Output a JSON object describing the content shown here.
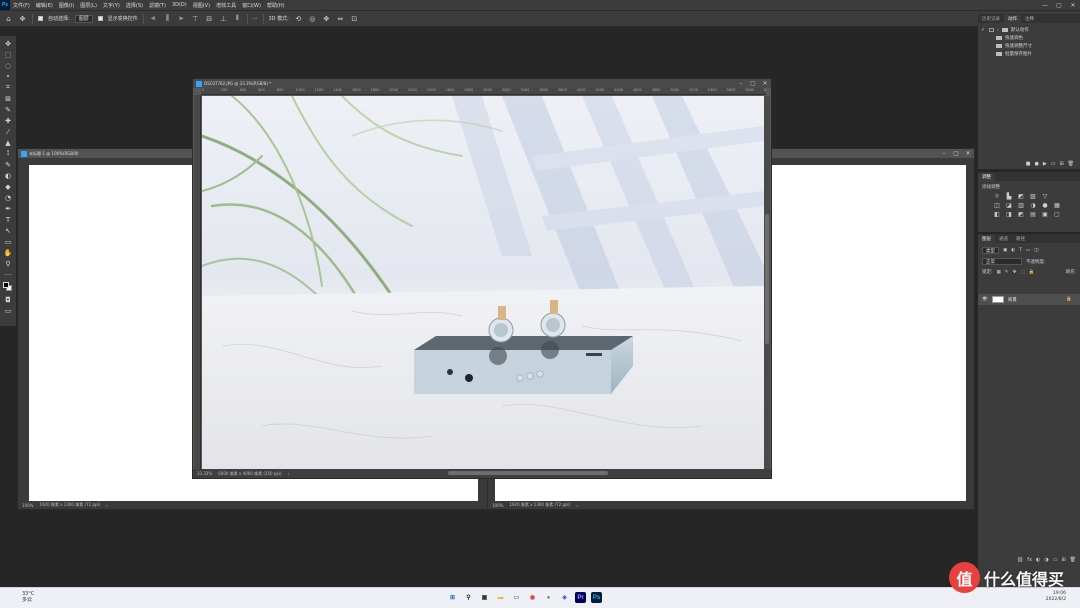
{
  "menubar": {
    "logo": "Ps",
    "items": [
      "文件(F)",
      "编辑(E)",
      "图像(I)",
      "图层(L)",
      "文字(Y)",
      "选择(S)",
      "滤镜(T)",
      "3D(D)",
      "视图(V)",
      "增效工具",
      "窗口(W)",
      "帮助(H)"
    ],
    "win_controls": [
      "—",
      "▢",
      "✕"
    ]
  },
  "options_bar": {
    "home_icon": "home-icon",
    "move_icon": "move-icon",
    "auto_select_label": "自动选择:",
    "layer_select": "图层",
    "show_transform_label": "显示变换控件",
    "more": "···",
    "mode_3d": "3D 模式:"
  },
  "toolbar": {
    "tools": [
      "✥",
      "⬚",
      "◌",
      "⬩",
      "⌗",
      "⊠",
      "✎",
      "✚",
      "⁄",
      "▲",
      "⟟",
      "✎",
      "◐",
      "◆",
      "◔",
      "✒",
      "T",
      "↖",
      "▭",
      "✋",
      "⚲",
      "···"
    ],
    "colors": {
      "foreground": "#000000",
      "background": "#ffffff"
    }
  },
  "doc_back_left": {
    "title": "未标题-1 @ 100%(RGB/8)",
    "status_zoom": "100%",
    "status_info": "1920 像素 x 1300 像素 (72 ppi)"
  },
  "doc_back_right": {
    "status_zoom": "100%",
    "status_info": "1920 像素 x 1300 像素 (72 ppi)"
  },
  "doc_front": {
    "title": "DSC07762.JPG @ 33.3%(RGB/8) *",
    "status_zoom": "33.33%",
    "status_info": "6000 像素 x 4000 像素 (350 ppi)",
    "ruler_ticks": [
      "0",
      "200",
      "400",
      "600",
      "800",
      "1000",
      "1200",
      "1400",
      "1600",
      "1800",
      "2000",
      "2200",
      "2400",
      "2600",
      "2800",
      "3000",
      "3200",
      "3400",
      "3600",
      "3800",
      "4000",
      "4200",
      "4400",
      "4600",
      "4800",
      "5000",
      "5200",
      "5400",
      "5600",
      "5800",
      "6000"
    ]
  },
  "panel_history": {
    "tabs": [
      "历史记录",
      "动作",
      "注释"
    ],
    "actions": [
      {
        "label": "默认动作",
        "folder": true
      },
      {
        "label": "快速调色",
        "folder": false
      },
      {
        "label": "快速调整尺寸",
        "folder": false
      },
      {
        "label": "批量保存图片",
        "folder": false
      }
    ]
  },
  "panel_adjust": {
    "tabs": [
      "调整"
    ],
    "subtitle": "添加调整",
    "icons": [
      "☼",
      "▙",
      "◩",
      "▨",
      "▽",
      "",
      "◫",
      "◪",
      "▥",
      "◑",
      "●",
      "▦",
      "◧",
      "◨",
      "◩",
      "▤",
      "▣",
      "▢"
    ]
  },
  "panel_layers": {
    "tabs": [
      "图层",
      "通道",
      "路径"
    ],
    "kind_label": "类型",
    "mode_label": "正常",
    "opacity_label": "不透明度:",
    "lock_label": "锁定:",
    "fill_label": "填充:",
    "layer_name": "背景"
  },
  "taskbar": {
    "weather_temp": "33°C",
    "weather_desc": "多云",
    "apps": [
      {
        "name": "start",
        "glyph": "⊞",
        "color": "#1f6fd6"
      },
      {
        "name": "search",
        "glyph": "⚲",
        "color": "#222222"
      },
      {
        "name": "taskview",
        "glyph": "▣",
        "color": "#333333"
      },
      {
        "name": "explorer",
        "glyph": "▬",
        "color": "#e8b530"
      },
      {
        "name": "files",
        "glyph": "▭",
        "color": "#4a8ee0"
      },
      {
        "name": "chrome",
        "glyph": "◉",
        "color": "#d94337"
      },
      {
        "name": "wechat",
        "glyph": "●",
        "color": "#27b03c"
      },
      {
        "name": "app",
        "glyph": "◈",
        "color": "#3a6ed0"
      },
      {
        "name": "premiere",
        "glyph": "Pr",
        "color": "#9999ff"
      },
      {
        "name": "photoshop",
        "glyph": "Ps",
        "color": "#31a8ff"
      }
    ],
    "clock_time": "19:06",
    "clock_date": "2022/8/2"
  },
  "watermark": {
    "logo": "值",
    "text": "什么值得买"
  }
}
